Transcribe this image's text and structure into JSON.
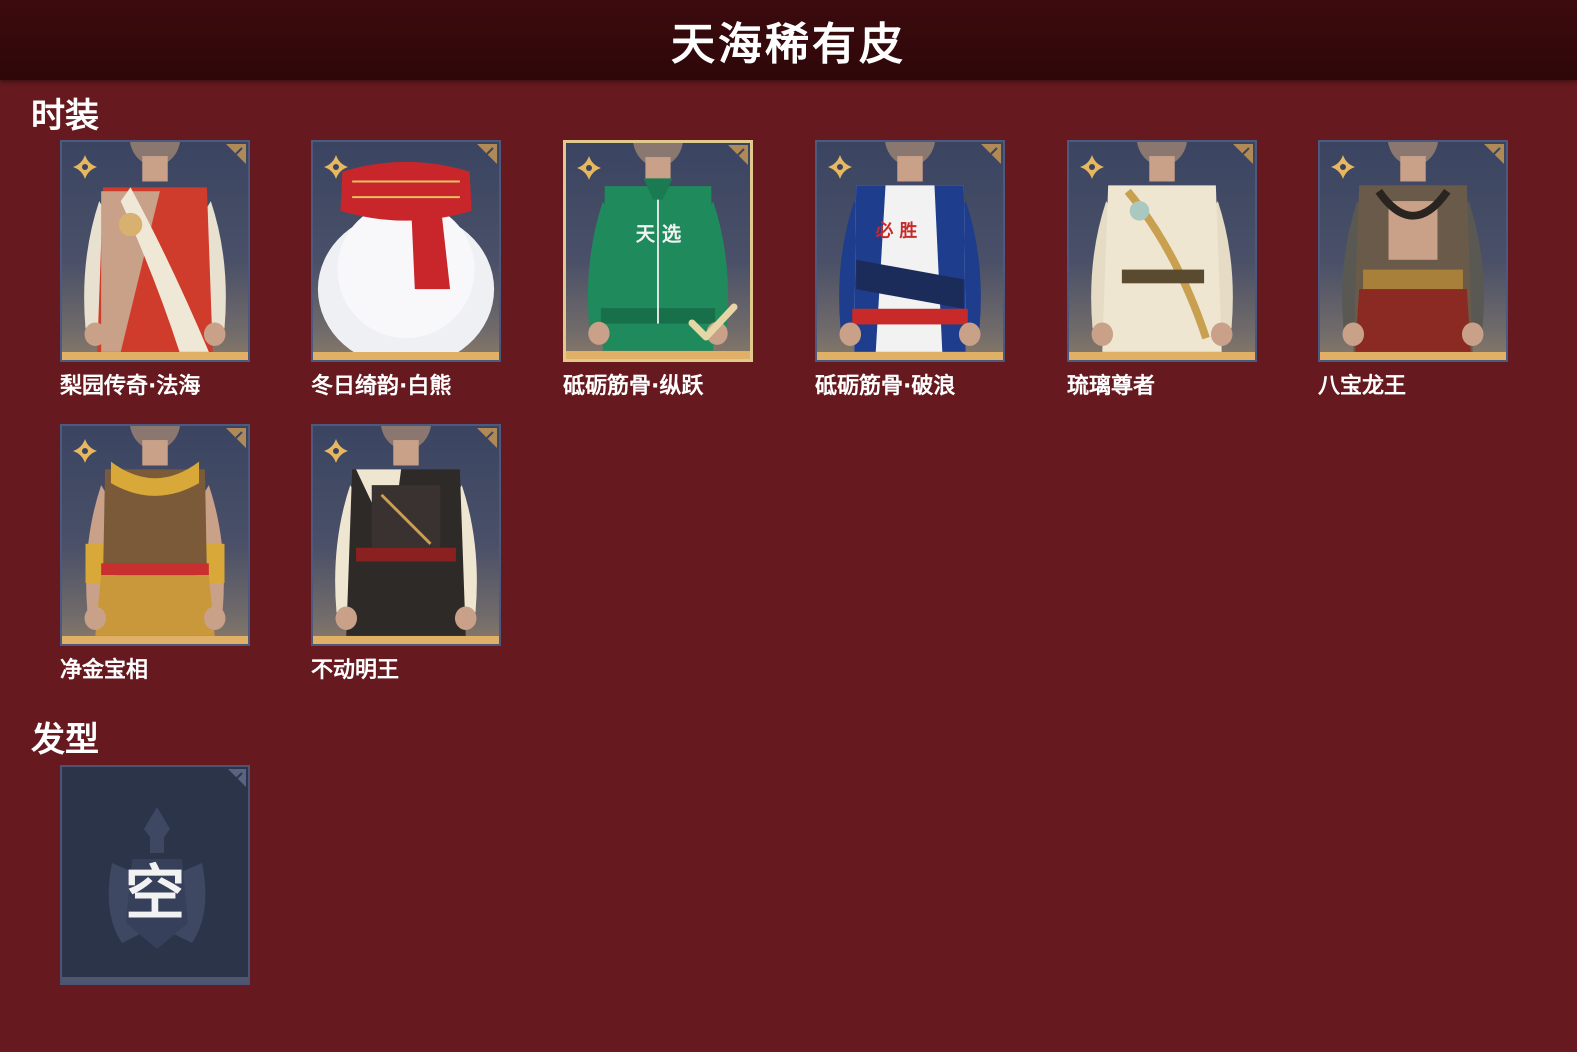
{
  "header": {
    "title": "天海稀有皮"
  },
  "sections": {
    "costume": {
      "title": "时装"
    },
    "hair": {
      "title": "发型"
    }
  },
  "costumes": [
    {
      "name": "梨园传奇·法海",
      "theme": "red-white-robe",
      "selected": false
    },
    {
      "name": "冬日绮韵·白熊",
      "theme": "polar-bear-scarf",
      "selected": false
    },
    {
      "name": "砥砺筋骨·纵跃",
      "theme": "green-tracksuit",
      "chest_text": "天 选",
      "selected": true
    },
    {
      "name": "砥砺筋骨·破浪",
      "theme": "blue-tracksuit",
      "chest_text": "必 胜",
      "selected": false
    },
    {
      "name": "琉璃尊者",
      "theme": "white-gold-robe",
      "selected": false
    },
    {
      "name": "八宝龙王",
      "theme": "dragon-armor",
      "selected": false
    },
    {
      "name": "净金宝相",
      "theme": "golden-armor",
      "selected": false
    },
    {
      "name": "不动明王",
      "theme": "dark-armor",
      "selected": false
    }
  ],
  "hair": {
    "empty_label": "空"
  },
  "colors": {
    "background": "#661a1f",
    "header": "#2e0709",
    "rarity_accent": "#e8b860",
    "card_border": "#4b5a7e",
    "selected_border": "#e0c98c"
  },
  "icons": {
    "rarity": "four-petal-star-icon",
    "corner": "corner-tag-icon",
    "selected": "checkmark-icon",
    "empty_slot": "helmet-emblem-icon"
  }
}
